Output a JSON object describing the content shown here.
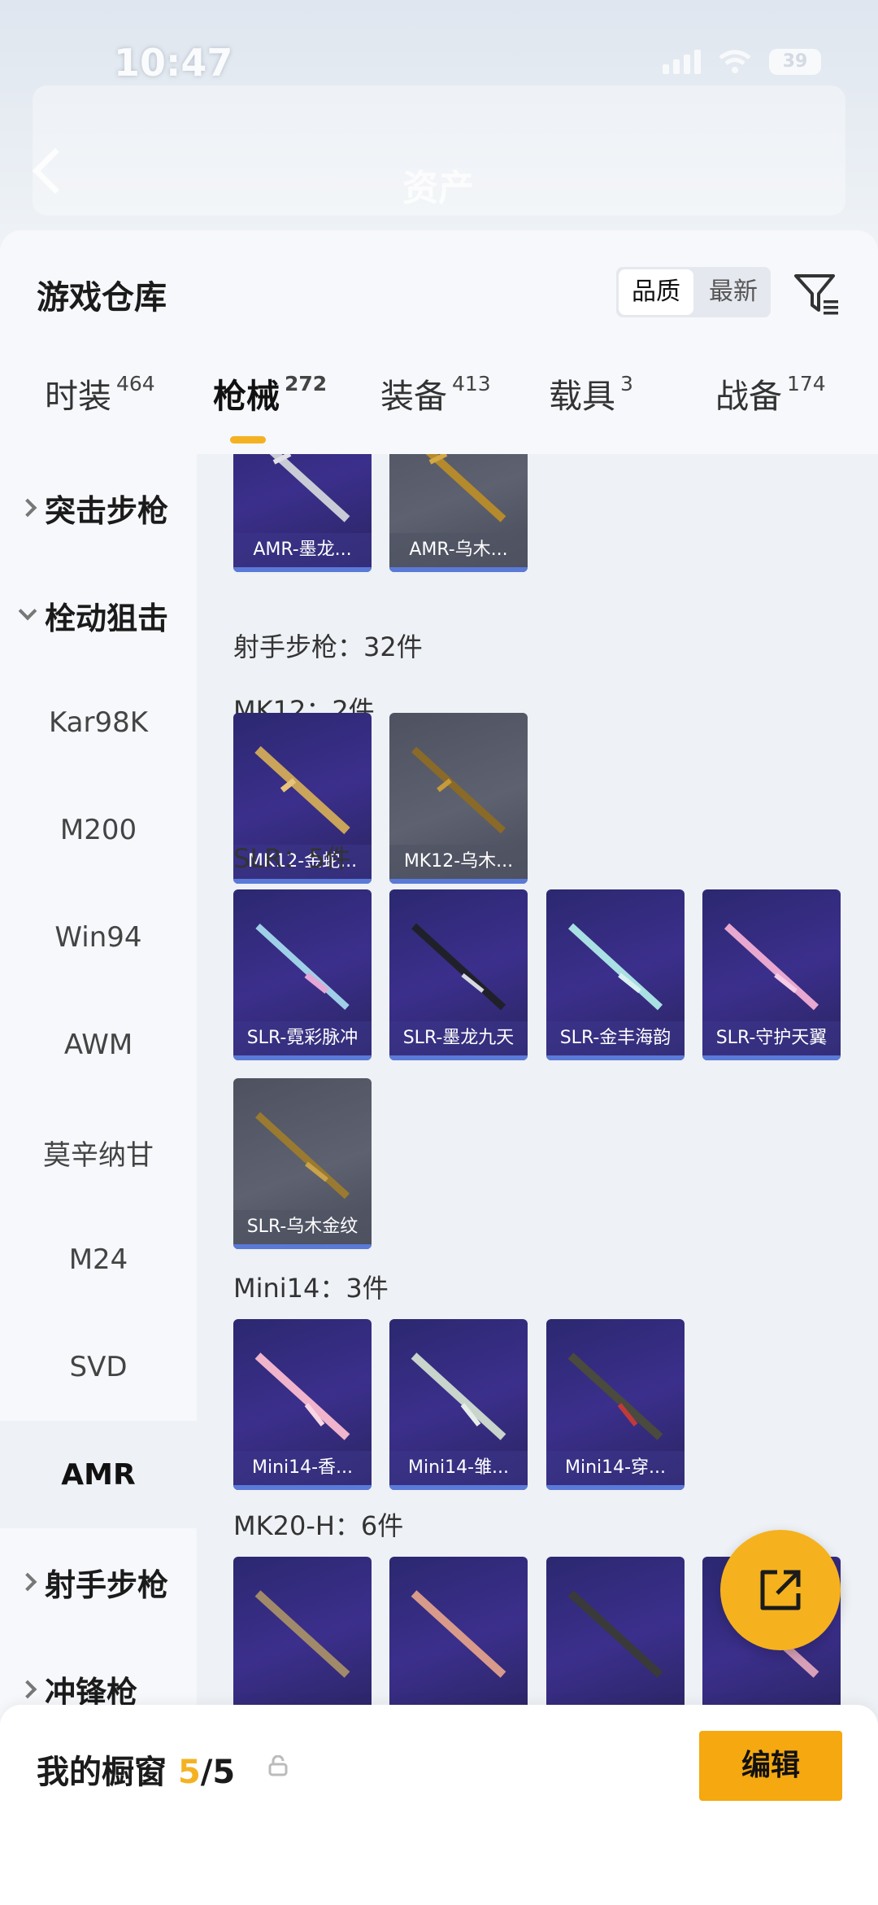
{
  "status": {
    "time": "10:47",
    "battery": "39"
  },
  "header": {
    "title": "资产"
  },
  "page_title": "游戏仓库",
  "sort": [
    "品质",
    "最新"
  ],
  "tabs": [
    {
      "label": "时装",
      "count": "464"
    },
    {
      "label": "枪械",
      "count": "272"
    },
    {
      "label": "装备",
      "count": "413"
    },
    {
      "label": "载具",
      "count": "3"
    },
    {
      "label": "战备",
      "count": "174"
    }
  ],
  "sidebar": {
    "items": [
      "突击步枪",
      "栓动狙击",
      "Kar98K",
      "M200",
      "Win94",
      "AWM",
      "莫辛纳甘",
      "M24",
      "SVD",
      "AMR",
      "射手步枪",
      "冲锋枪"
    ]
  },
  "content": {
    "sections": [
      "射手步枪：32件",
      "MK12：2件",
      "SLR：5件",
      "Mini14：3件",
      "MK20-H：6件"
    ],
    "cards": {
      "amr": [
        "AMR-墨龙...",
        "AMR-乌木..."
      ],
      "mk12": [
        "MK12-金蛇...",
        "MK12-乌木..."
      ],
      "slr": [
        "SLR-霓彩脉冲",
        "SLR-墨龙九天",
        "SLR-金丰海韵",
        "SLR-守护天翼",
        "SLR-乌木金纹"
      ],
      "mini14": [
        "Mini14-香...",
        "Mini14-雏...",
        "Mini14-穿..."
      ]
    },
    "colors": {
      "purple_card": "#342c7e",
      "gray_card": "#555968",
      "accent": "#f4b223"
    }
  },
  "bottom": {
    "label": "我的橱窗",
    "count": "5",
    "total": "/5",
    "edit": "编辑"
  }
}
